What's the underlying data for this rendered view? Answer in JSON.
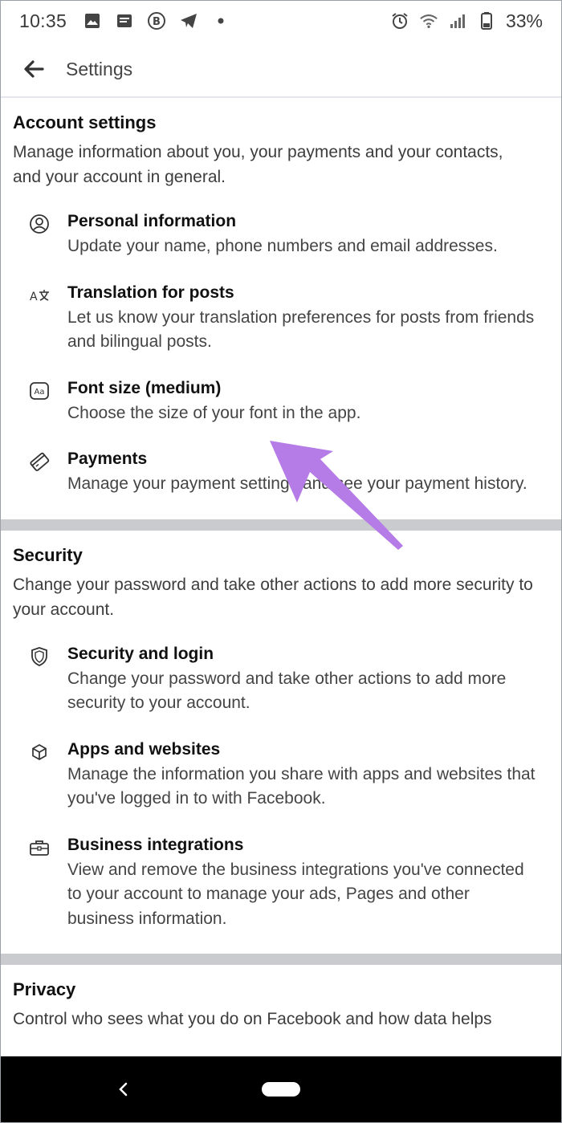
{
  "status_bar": {
    "time": "10:35",
    "battery": "33%",
    "left_icons": [
      "gallery-icon",
      "message-icon",
      "b-circle-icon",
      "telegram-icon",
      "dot-icon"
    ],
    "right_icons": [
      "alarm-icon",
      "wifi-icon",
      "signal-icon",
      "battery-icon"
    ]
  },
  "header": {
    "title": "Settings"
  },
  "sections": [
    {
      "title": "Account settings",
      "description": "Manage information about you, your payments and your contacts, and your account in general.",
      "items": [
        {
          "icon": "person-circle-icon",
          "title": "Personal information",
          "description": "Update your name, phone numbers and email addresses."
        },
        {
          "icon": "translate-icon",
          "title": "Translation for posts",
          "description": "Let us know your translation preferences for posts from friends and bilingual posts."
        },
        {
          "icon": "font-size-icon",
          "title": "Font size (medium)",
          "description": "Choose the size of your font in the app."
        },
        {
          "icon": "payment-card-icon",
          "title": "Payments",
          "description": "Manage your payment settings and see your payment history."
        }
      ]
    },
    {
      "title": "Security",
      "description": "Change your password and take other actions to add more security to your account.",
      "items": [
        {
          "icon": "shield-icon",
          "title": "Security and login",
          "description": "Change your password and take other actions to add more security to your account."
        },
        {
          "icon": "cube-icon",
          "title": "Apps and websites",
          "description": "Manage the information you share with apps and websites that you've logged in to with Facebook."
        },
        {
          "icon": "briefcase-icon",
          "title": "Business integrations",
          "description": "View and remove the business integrations you've connected to your account to manage your ads, Pages and other business information."
        }
      ]
    },
    {
      "title": "Privacy",
      "description": "Control who sees what you do on Facebook and how data helps"
    }
  ],
  "colors": {
    "arrow": "#b57be6",
    "divider": "#c9cbcf",
    "navbar": "#000000"
  }
}
